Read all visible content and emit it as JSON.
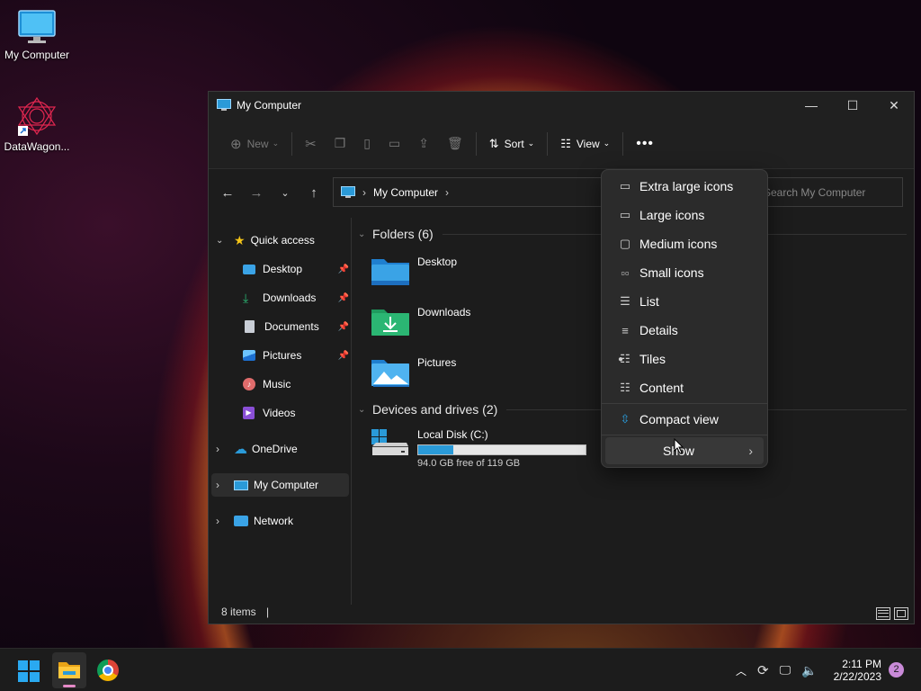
{
  "desktop": {
    "icons": [
      {
        "label": "My Computer"
      },
      {
        "label": "DataWagon..."
      }
    ]
  },
  "window": {
    "title": "My Computer",
    "toolbar": {
      "new_label": "New",
      "sort_label": "Sort",
      "view_label": "View"
    },
    "address": {
      "crumb": "My Computer",
      "search_placeholder": "Search My Computer"
    },
    "sidebar": {
      "items": [
        {
          "label": "Quick access"
        },
        {
          "label": "Desktop"
        },
        {
          "label": "Downloads"
        },
        {
          "label": "Documents"
        },
        {
          "label": "Pictures"
        },
        {
          "label": "Music"
        },
        {
          "label": "Videos"
        },
        {
          "label": "OneDrive"
        },
        {
          "label": "My Computer"
        },
        {
          "label": "Network"
        }
      ]
    },
    "content": {
      "folders_header": "Folders (6)",
      "folders": [
        {
          "name": "Desktop"
        },
        {
          "name": "Downloads"
        },
        {
          "name": "Pictures"
        }
      ],
      "devices_header": "Devices and drives (2)",
      "drive": {
        "name": "Local Disk (C:)",
        "free_text": "94.0 GB free of 119 GB",
        "used_fraction": 0.21
      }
    },
    "status": {
      "items_text": "8 items"
    }
  },
  "view_menu": {
    "items": [
      {
        "label": "Extra large icons"
      },
      {
        "label": "Large icons"
      },
      {
        "label": "Medium icons"
      },
      {
        "label": "Small icons"
      },
      {
        "label": "List"
      },
      {
        "label": "Details"
      },
      {
        "label": "Tiles"
      },
      {
        "label": "Content"
      },
      {
        "label": "Compact view"
      },
      {
        "label": "Show"
      }
    ],
    "selected": "Tiles"
  },
  "taskbar": {
    "time": "2:11 PM",
    "date": "2/22/2023",
    "notification_count": "2"
  },
  "colors": {
    "accent": "#2a9ad8",
    "folder_blue": "#3aa3e6",
    "folder_green": "#2bb673"
  }
}
